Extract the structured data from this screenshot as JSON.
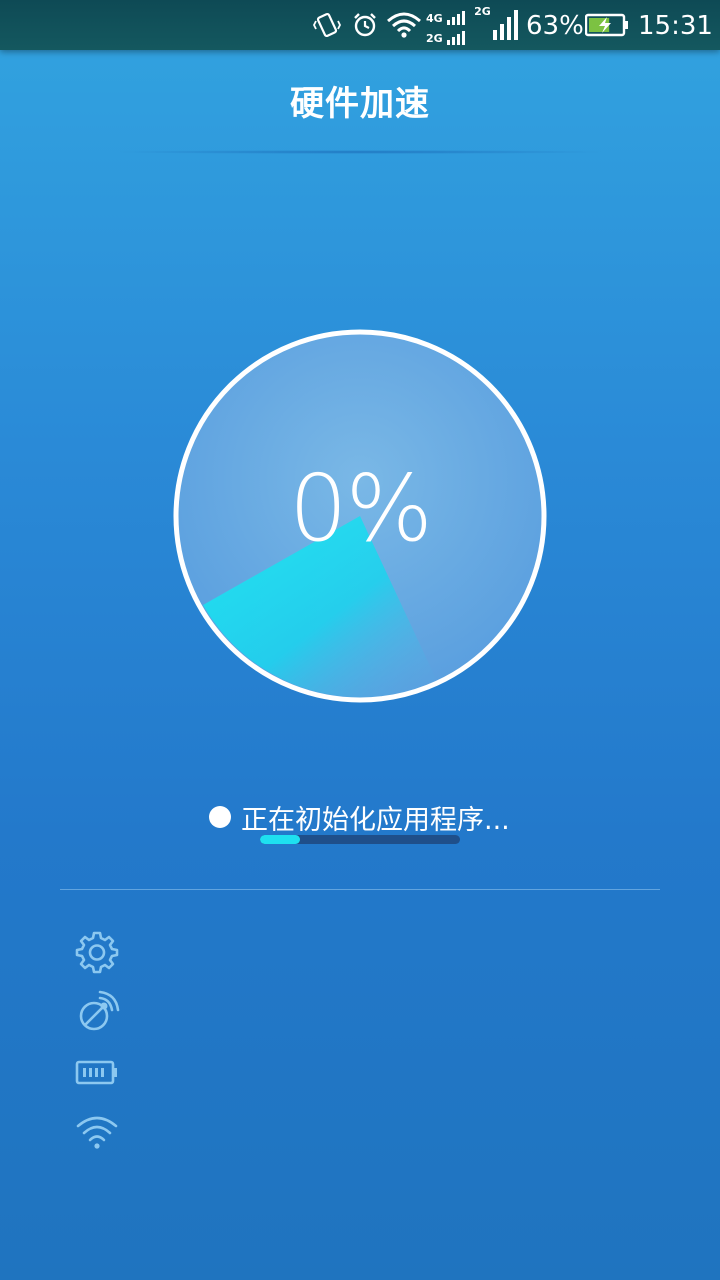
{
  "status_bar": {
    "network_top": "4G",
    "network_bottom": "2G",
    "network_2": "2G",
    "battery_percent": "63%",
    "battery_level": 0.63,
    "time": "15:31"
  },
  "header": {
    "title": "硬件加速"
  },
  "gauge": {
    "value_text": "0%",
    "value": 0
  },
  "loading": {
    "text": "正在初始化应用程序...",
    "progress": 0.2
  },
  "features": [
    {
      "icon": "gear-icon"
    },
    {
      "icon": "gps-off-icon"
    },
    {
      "icon": "battery-icon"
    },
    {
      "icon": "wifi-icon"
    }
  ],
  "colors": {
    "background_top": "#32a4e0",
    "background_bottom": "#1f74bf",
    "accent_cyan": "#1ee0f0",
    "status_bar": "#0e4a55"
  }
}
